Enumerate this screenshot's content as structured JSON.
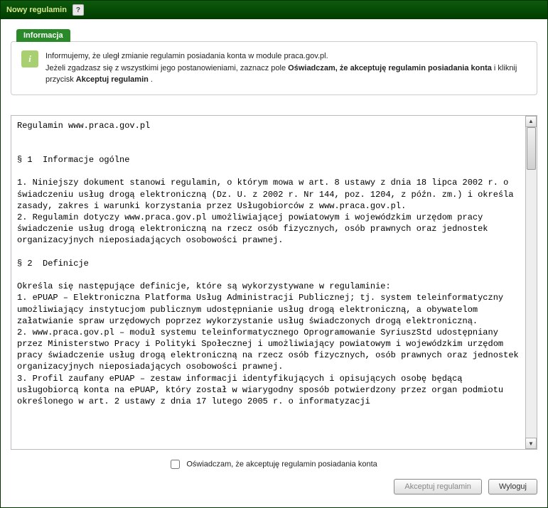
{
  "window": {
    "title": "Nowy regulamin",
    "help": "?"
  },
  "info": {
    "tab": "Informacja",
    "icon": "i",
    "line1": "Informujemy, że uległ zmianie regulamin posiadania konta w module praca.gov.pl.",
    "line2a": "Jeżeli zgadzasz się z wszystkimi jego postanowieniami, zaznacz pole ",
    "line2b": "Oświadczam, że akceptuję regulamin posiadania konta",
    "line2c": " i kliknij przycisk ",
    "line2d": "Akceptuj regulamin",
    "line2e": " ."
  },
  "regs": "Regulamin www.praca.gov.pl\n\n\n§ 1  Informacje ogólne\n\n1. Niniejszy dokument stanowi regulamin, o którym mowa w art. 8 ustawy z dnia 18 lipca 2002 r. o świadczeniu usług drogą elektroniczną (Dz. U. z 2002 r. Nr 144, poz. 1204, z późn. zm.) i określa zasady, zakres i warunki korzystania przez Usługobiorców z www.praca.gov.pl.\n2. Regulamin dotyczy www.praca.gov.pl umożliwiającej powiatowym i wojewódzkim urzędom pracy świadczenie usług drogą elektroniczną na rzecz osób fizycznych, osób prawnych oraz jednostek organizacyjnych nieposiadających osobowości prawnej.\n\n§ 2  Definicje\n\nOkreśla się następujące definicje, które są wykorzystywane w regulaminie:\n1. ePUAP – Elektroniczna Platforma Usług Administracji Publicznej; tj. system teleinformatyczny umożliwiający instytucjom publicznym udostępnianie usług drogą elektroniczną, a obywatelom załatwianie spraw urzędowych poprzez wykorzystanie usług świadczonych drogą elektroniczną.\n2. www.praca.gov.pl – moduł systemu teleinformatycznego Oprogramowanie SyriuszStd udostępniany przez Ministerstwo Pracy i Polityki Społecznej i umożliwiający powiatowym i wojewódzkim urzędom pracy świadczenie usług drogą elektroniczną na rzecz osób fizycznych, osób prawnych oraz jednostek organizacyjnych nieposiadających osobowości prawnej.\n3. Profil zaufany ePUAP – zestaw informacji identyfikujących i opisujących osobę będącą usługobiorcą konta na ePUAP, który został w wiarygodny sposób potwierdzony przez organ podmiotu określonego w art. 2 ustawy z dnia 17 lutego 2005 r. o informatyzacji",
  "checkbox": {
    "label": "Oświadczam, że akceptuję regulamin posiadania konta"
  },
  "buttons": {
    "accept": "Akceptuj regulamin",
    "logout": "Wyloguj"
  }
}
